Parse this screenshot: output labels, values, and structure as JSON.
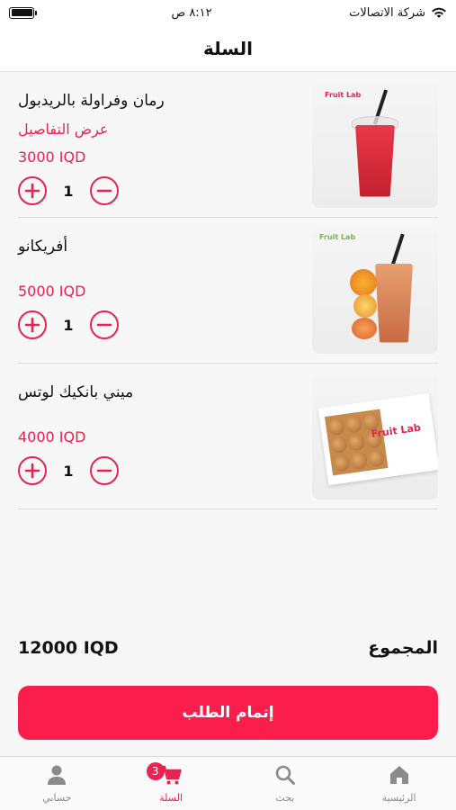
{
  "status_bar": {
    "carrier": "شركة الاتصالات",
    "time": "٨:١٢ ص"
  },
  "header": {
    "title": "السلة"
  },
  "cart": {
    "items": [
      {
        "name": "رمان وفراولة بالريدبول",
        "details_link": "عرض التفاصيل",
        "price": "3000 IQD",
        "quantity": "1",
        "image": "red-drink-cup"
      },
      {
        "name": "أفريكانو",
        "details_link": "",
        "price": "5000 IQD",
        "quantity": "1",
        "image": "orange-drink-cup"
      },
      {
        "name": "ميني بانكيك لوتس",
        "details_link": "",
        "price": "4000 IQD",
        "quantity": "1",
        "image": "pancake-box"
      }
    ]
  },
  "total": {
    "label": "المجموع",
    "amount": "12000 IQD"
  },
  "checkout": {
    "label": "إتمام الطلب"
  },
  "tab_bar": {
    "tabs": [
      {
        "label": "الرئيسية",
        "icon": "home-icon"
      },
      {
        "label": "بحث",
        "icon": "search-icon"
      },
      {
        "label": "السلة",
        "icon": "cart-icon",
        "badge": "3"
      },
      {
        "label": "حسابي",
        "icon": "user-icon"
      }
    ]
  },
  "colors": {
    "accent": "#fb1d4c",
    "text": "#111111",
    "muted": "#888888"
  }
}
